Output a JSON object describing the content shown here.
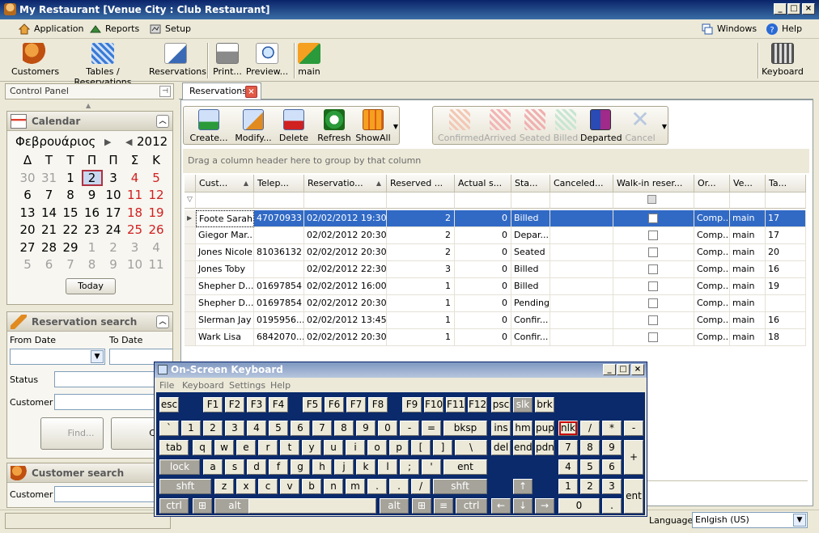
{
  "window": {
    "title": "My Restaurant [Venue City : Club Restaurant]"
  },
  "menu": {
    "application": "Application",
    "reports": "Reports",
    "setup": "Setup",
    "windows": "Windows",
    "help": "Help"
  },
  "toolbar": {
    "customers": "Customers",
    "tables": "Tables / Reservations",
    "reservations": "Reservations",
    "print": "Print...",
    "preview": "Preview...",
    "main": "main",
    "keyboard": "Keyboard"
  },
  "control_panel": {
    "title": "Control Panel"
  },
  "calendar": {
    "title": "Calendar",
    "month": "Φεβρουάριος",
    "year": "2012",
    "weekdays": [
      "Δ",
      "Τ",
      "Τ",
      "Π",
      "Π",
      "Σ",
      "Κ"
    ],
    "weeks": [
      [
        "30",
        "31",
        "1",
        "2",
        "3",
        "4",
        "5"
      ],
      [
        "6",
        "7",
        "8",
        "9",
        "10",
        "11",
        "12"
      ],
      [
        "13",
        "14",
        "15",
        "16",
        "17",
        "18",
        "19"
      ],
      [
        "20",
        "21",
        "22",
        "23",
        "24",
        "25",
        "26"
      ],
      [
        "27",
        "28",
        "29",
        "1",
        "2",
        "3",
        "4"
      ],
      [
        "5",
        "6",
        "7",
        "8",
        "9",
        "10",
        "11"
      ]
    ],
    "today_label": "Today"
  },
  "reservation_search": {
    "title": "Reservation search",
    "from_date": "From Date",
    "to_date": "To Date",
    "status": "Status",
    "customer": "Customer",
    "find": "Find...",
    "clear": "Cle"
  },
  "customer_search": {
    "title": "Customer search",
    "customer": "Customer"
  },
  "tab": {
    "label": "Reservations"
  },
  "ribbon": {
    "create": "Create...",
    "modify": "Modify...",
    "delete": "Delete",
    "refresh": "Refresh",
    "showall": "ShowAll",
    "confirmed": "Confirmed",
    "arrived": "Arrived",
    "seated": "Seated",
    "billed": "Billed",
    "departed": "Departed",
    "cancel": "Cancel"
  },
  "group_hint": "Drag a column header here to group by that column",
  "grid": {
    "columns": [
      "Cust...",
      "Telep...",
      "Reservatio...",
      "Reserved ...",
      "Actual s...",
      "Sta...",
      "Canceled...",
      "Walk-in reser...",
      "Or...",
      "Ve...",
      "Ta..."
    ],
    "sort_up": "▲",
    "rows": [
      [
        "Foote Sarah",
        "47070933",
        "02/02/2012 19:30",
        "2",
        "0",
        "Billed",
        "",
        "",
        "Comp...",
        "main",
        "17"
      ],
      [
        "Giegor Mar...",
        "",
        "02/02/2012 20:30",
        "2",
        "0",
        "Depar...",
        "",
        "",
        "Comp...",
        "main",
        "17"
      ],
      [
        "Jones Nicole",
        "81036132",
        "02/02/2012 20:30",
        "2",
        "0",
        "Seated",
        "",
        "",
        "Comp...",
        "main",
        "20"
      ],
      [
        "Jones Toby",
        "",
        "02/02/2012 22:30",
        "3",
        "0",
        "Billed",
        "",
        "",
        "Comp...",
        "main",
        "16"
      ],
      [
        "Shepher D...",
        "01697854",
        "02/02/2012 16:00",
        "1",
        "0",
        "Billed",
        "",
        "",
        "Comp...",
        "main",
        "19"
      ],
      [
        "Shepher D...",
        "01697854",
        "02/02/2012 20:30",
        "1",
        "0",
        "Pending",
        "",
        "",
        "Comp...",
        "main",
        ""
      ],
      [
        "Slerman Jay",
        "0195956...",
        "02/02/2012 13:45",
        "1",
        "0",
        "Confir...",
        "",
        "",
        "Comp...",
        "main",
        "16"
      ],
      [
        "Wark Lisa",
        "6842070...",
        "02/02/2012 20:30",
        "1",
        "0",
        "Confir...",
        "",
        "",
        "Comp...",
        "main",
        "18"
      ]
    ]
  },
  "osk": {
    "title": "On-Screen Keyboard",
    "menu": [
      "File",
      "Keyboard",
      "Settings",
      "Help"
    ]
  },
  "status": {
    "language_label": "Language",
    "language_value": "Enlgish (US)"
  }
}
